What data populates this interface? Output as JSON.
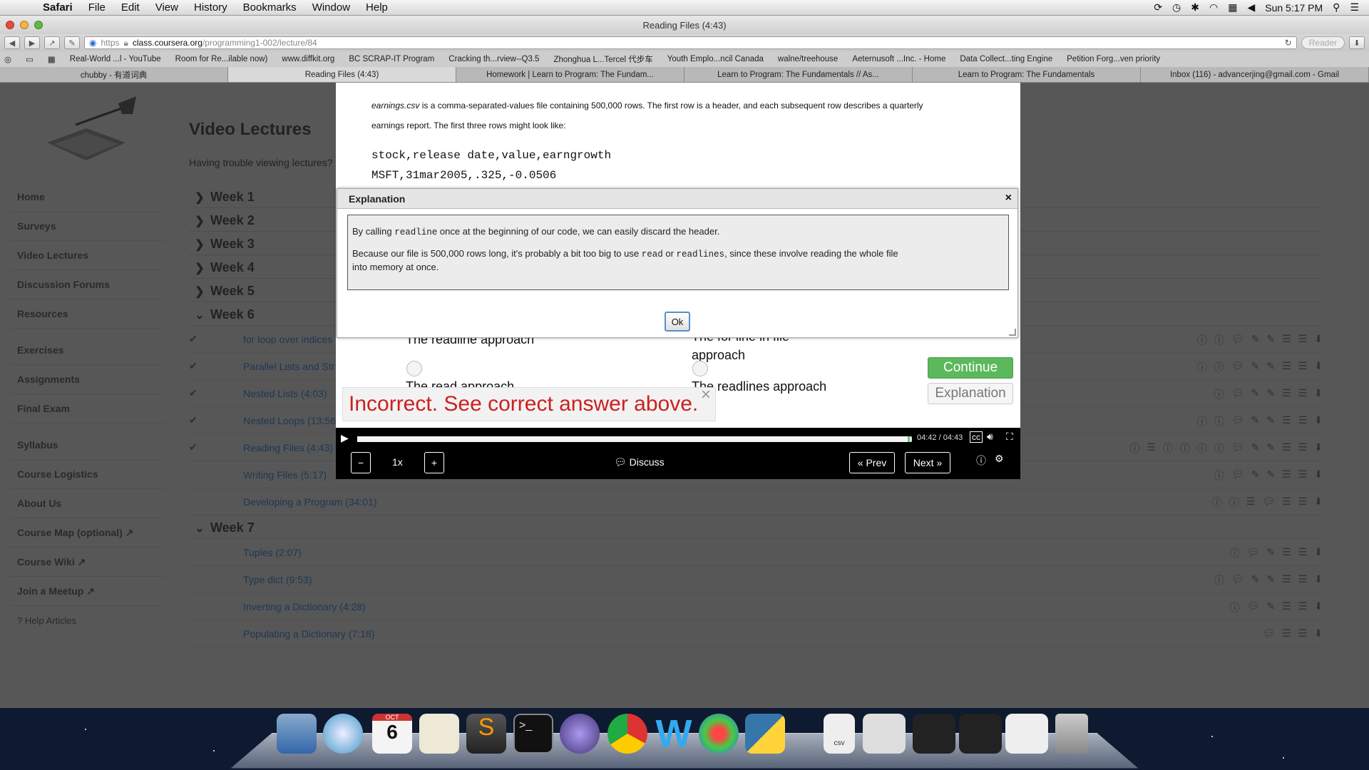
{
  "menubar": {
    "app": "Safari",
    "items": [
      "File",
      "Edit",
      "View",
      "History",
      "Bookmarks",
      "Window",
      "Help"
    ],
    "clock": "Sun 5:17 PM"
  },
  "window": {
    "title": "Reading Files (4:43)"
  },
  "toolbar": {
    "url_scheme": "https",
    "url_host": "class.coursera.org",
    "url_path": "/programming1-002/lecture/84",
    "reader": "Reader"
  },
  "bookmarks": [
    "Real-World ...l - YouTube",
    "Room for Re...ilable now)",
    "www.diffkit.org",
    "BC SCRAP-IT Program",
    "Cracking th...rview--Q3.5",
    "Zhonghua L...Tercel 代步车",
    "Youth Emplo...ncil Canada",
    "walne/treehouse",
    "Aeternusoft ...Inc. - Home",
    "Data Collect...ting Engine",
    "Petition Forg...ven priority"
  ],
  "tabs": [
    "chubby - 有道词典",
    "Reading Files (4:43)",
    "Homework | Learn to Program: The Fundam...",
    "Learn to Program: The Fundamentals // As...",
    "Learn to Program: The Fundamentals",
    "Inbox (116) - advancerjing@gmail.com - Gmail"
  ],
  "sidebar": {
    "items": [
      "Home",
      "Surveys",
      "Video Lectures",
      "Discussion Forums",
      "Resources"
    ],
    "items2": [
      "Exercises",
      "Assignments",
      "Final Exam"
    ],
    "items3": [
      "Syllabus",
      "Course Logistics",
      "About Us",
      "Course Map (optional)",
      "Course Wiki",
      "Join a Meetup"
    ],
    "help": "Help Articles"
  },
  "main": {
    "heading": "Video Lectures",
    "sub": "Having trouble viewing lectures?",
    "weeks": [
      "Week 1",
      "Week 2",
      "Week 3",
      "Week 4",
      "Week 5",
      "Week 6",
      "Week 7"
    ],
    "week6_lectures": [
      "for loop over indices",
      "Parallel Lists and Str",
      "Nested Lists (4:03)",
      "Nested Loops (13:56",
      "Reading Files (4:43)",
      "Writing Files (5:17)",
      "Developing a Program (34:01)"
    ],
    "week7_lectures": [
      "Tuples (2:07)",
      "Type dict (9:53)",
      "Inverting a Dictionary (4:28)",
      "Populating a Dictionary (7:18)"
    ]
  },
  "question": {
    "intro_italic": "earnings.csv",
    "intro_rest": " is a comma-separated-values file containing 500,000 rows. The first row is a header, and each subsequent row describes a quarterly",
    "intro2": "earnings report. The first three rows might look like:",
    "code1": "stock,release date,value,earngrowth",
    "code2": "MSFT,31mar2005,.325,-0.0506",
    "opt1": "The readline approach",
    "opt2a": "The for line in file",
    "opt2b": "approach",
    "opt3": "The read approach",
    "opt4": "The readlines approach",
    "continue": "Continue",
    "explanation_btn": "Explanation",
    "incorrect": "Incorrect. See correct answer above."
  },
  "dialog": {
    "title": "Explanation",
    "close": "×",
    "p1a": "By calling ",
    "p1code": "readline",
    "p1b": " once at the beginning of our code, we can easily discard the header.",
    "p2a": "Because our file is 500,000 rows long, it's probably a bit too big to use ",
    "p2code1": "read",
    "p2b": " or ",
    "p2code2": "readlines",
    "p2c": ", since these involve reading the whole file",
    "p2d": "into memory at once.",
    "ok": "Ok"
  },
  "player": {
    "time": "04:42 / 04:43",
    "progress": 0.996,
    "speed": "1x",
    "discuss": "Discuss",
    "prev": "« Prev",
    "next": "Next »"
  },
  "dock": {
    "calendar_month": "OCT",
    "calendar_day": "6"
  }
}
